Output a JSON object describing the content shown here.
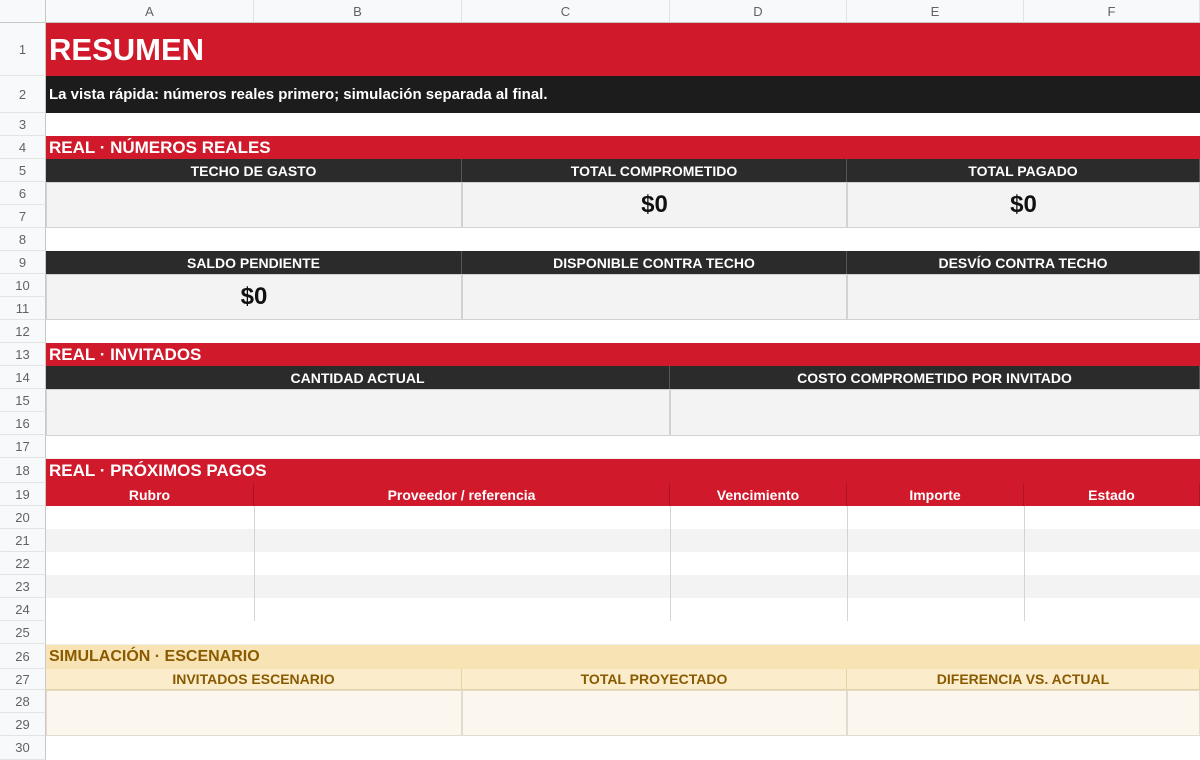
{
  "columns": [
    "A",
    "B",
    "C",
    "D",
    "E",
    "F"
  ],
  "rows": [
    "1",
    "2",
    "3",
    "4",
    "5",
    "6",
    "7",
    "8",
    "9",
    "10",
    "11",
    "12",
    "13",
    "14",
    "15",
    "16",
    "17",
    "18",
    "19",
    "20",
    "21",
    "22",
    "23",
    "24",
    "25",
    "26",
    "27",
    "28",
    "29",
    "30"
  ],
  "title": "RESUMEN",
  "subtitle": "La vista rápida: números reales primero; simulación separada al final.",
  "real_numbers": {
    "section": "REAL · NÚMEROS REALES",
    "headers": [
      "TECHO DE GASTO",
      "TOTAL COMPROMETIDO",
      "TOTAL PAGADO",
      "SALDO PENDIENTE",
      "DISPONIBLE CONTRA TECHO",
      "DESVÍO CONTRA TECHO"
    ],
    "values": [
      "",
      "$0",
      "$0",
      "$0",
      "",
      ""
    ]
  },
  "guests": {
    "section": "REAL · INVITADOS",
    "headers": [
      "CANTIDAD ACTUAL",
      "COSTO COMPROMETIDO POR INVITADO"
    ]
  },
  "payments": {
    "section": "REAL · PRÓXIMOS PAGOS",
    "headers": [
      "Rubro",
      "Proveedor / referencia",
      "Vencimiento",
      "Importe",
      "Estado"
    ]
  },
  "simulation": {
    "section": "SIMULACIÓN · ESCENARIO",
    "headers": [
      "INVITADOS ESCENARIO",
      "TOTAL PROYECTADO",
      "DIFERENCIA VS. ACTUAL"
    ]
  },
  "colors": {
    "accent_red": "#d0192b",
    "header_dark": "#2b2b2b",
    "sim_yellow": "#f7e3b3"
  }
}
